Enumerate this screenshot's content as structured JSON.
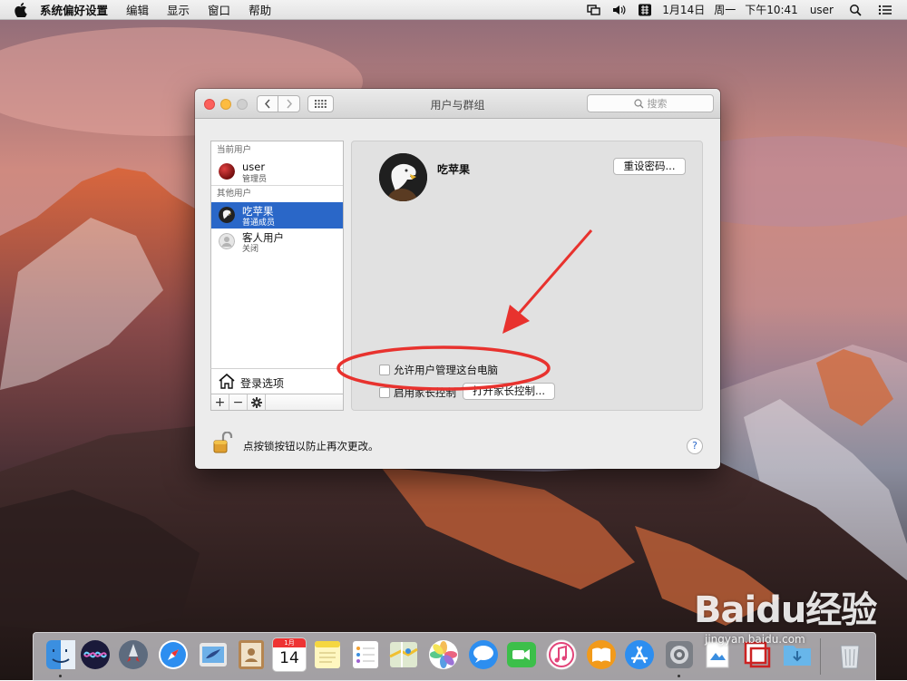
{
  "menubar": {
    "app_name": "系统偏好设置",
    "menus": [
      "编辑",
      "显示",
      "窗口",
      "帮助"
    ],
    "date": "1月14日",
    "weekday": "周一",
    "time": "下午10:41",
    "user": "user",
    "status_icons": [
      "screen-mirroring-icon",
      "volume-icon",
      "input-method-icon",
      "search-icon",
      "menu-list-icon"
    ]
  },
  "window": {
    "title": "用户与群组",
    "search_placeholder": "搜索",
    "user_list": {
      "current_header": "当前用户",
      "current_user": {
        "name": "user",
        "role": "管理员"
      },
      "other_header": "其他用户",
      "other_users": [
        {
          "name": "吃苹果",
          "role": "普通成员",
          "selected": true
        },
        {
          "name": "客人用户",
          "role": "关闭",
          "selected": false
        }
      ],
      "login_options": "登录选项",
      "add_symbol": "+",
      "remove_symbol": "−",
      "gear_symbol": "✱"
    },
    "detail": {
      "name": "吃苹果",
      "reset_password": "重设密码...",
      "allow_admin": "允许用户管理这台电脑",
      "enable_parental": "启用家长控制",
      "open_parental": "打开家长控制..."
    },
    "lock_text": "点按锁按钮以防止再次更改。",
    "help": "?"
  },
  "dock": {
    "apps": [
      "finder-icon",
      "siri-icon",
      "launchpad-icon",
      "safari-icon",
      "mail-icon",
      "contacts-icon",
      "calendar-icon",
      "notes-icon",
      "reminders-icon",
      "maps-icon",
      "photos-icon",
      "messages-icon",
      "facetime-icon",
      "itunes-icon",
      "ibooks-icon",
      "app-store-icon",
      "system-preferences-icon",
      "preview-icon",
      "parallels-icon",
      "downloads-folder-icon",
      "trash-icon"
    ],
    "calendar_month": "1月",
    "calendar_day": "14"
  },
  "watermark": {
    "logo": "Baidu经验",
    "url": "jingyan.baidu.com"
  },
  "colors": {
    "selection": "#2a67c8",
    "annotation": "#e8322e"
  }
}
